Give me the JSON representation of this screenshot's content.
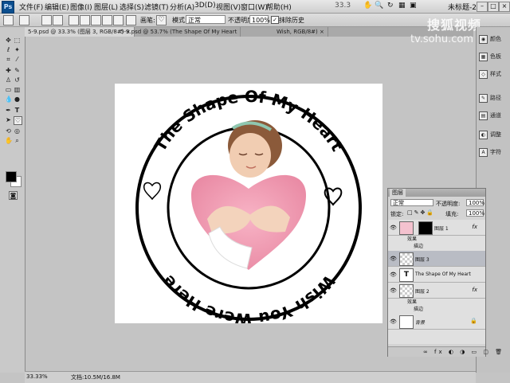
{
  "menubar": {
    "logo": "Ps",
    "items": [
      "文件(F)",
      "编辑(E)",
      "图像(I)",
      "图层(L)",
      "选择(S)",
      "滤镜(T)",
      "分析(A)",
      "3D(D)",
      "视图(V)",
      "窗口(W)",
      "帮助(H)"
    ],
    "zoom": "33.3",
    "workspace": "未标题-2"
  },
  "optbar": {
    "brush_label": "画笔:",
    "mode_label": "模式:",
    "mode_value": "正常",
    "opacity_label": "不透明度:",
    "opacity_value": "100%",
    "erase_label": "抹除历史",
    "erase_checked": "✓"
  },
  "watermark": {
    "line1": "搜狐视频",
    "line2": "tv.sohu.com"
  },
  "tabs": [
    {
      "label": "5-9.psd @ 33.3% (图层 3, RGB/8#) ×",
      "active": true
    },
    {
      "label": "5-9.psd @ 53.7% (The Shape Of My Heart",
      "active": false
    },
    {
      "label": "Wish, RGB/8#) ×",
      "active": false
    }
  ],
  "artwork": {
    "top_text": "The Shape Of My Heart",
    "bottom_text": "Wish You Were Here"
  },
  "dock": {
    "items": [
      {
        "icon": "◉",
        "label": "颜色"
      },
      {
        "icon": "▦",
        "label": "色板"
      },
      {
        "icon": "◇",
        "label": "样式"
      },
      {
        "icon": "✎",
        "label": "路径"
      },
      {
        "icon": "▤",
        "label": "通道"
      },
      {
        "icon": "◐",
        "label": "调整"
      },
      {
        "icon": "A",
        "label": "字符"
      }
    ]
  },
  "layers_panel": {
    "tab": "图层",
    "blend_mode": "正常",
    "opacity_label": "不透明度:",
    "opacity_value": "100%",
    "lock_label": "锁定:",
    "fill_label": "填充:",
    "fill_value": "100%",
    "effects_label": "效果",
    "stroke_label": "描边",
    "layers": [
      {
        "name": "图层 1",
        "thumb": "",
        "fx": "fx",
        "selected": false
      },
      {
        "name": "图层 3",
        "thumb": "",
        "fx": "",
        "selected": true
      },
      {
        "name": "The Shape Of My Heart",
        "thumb": "T",
        "fx": "",
        "selected": false
      },
      {
        "name": "图层 2",
        "thumb": "",
        "fx": "fx",
        "selected": false
      },
      {
        "name": "背景",
        "thumb": "",
        "fx": "",
        "selected": false
      }
    ]
  },
  "status": {
    "zoom": "33.33%",
    "doc": "文档:10.5M/16.8M"
  }
}
